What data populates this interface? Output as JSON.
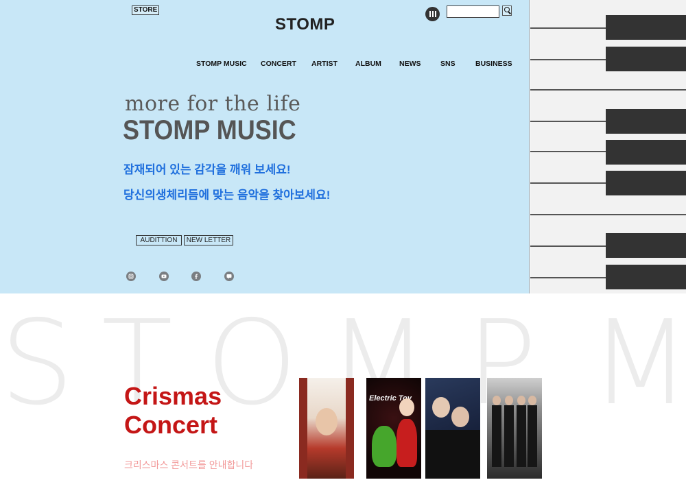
{
  "header": {
    "store_label": "STORE",
    "logo": "STOMP",
    "search_placeholder": ""
  },
  "nav": [
    "STOMP MUSIC",
    "CONCERT",
    "ARTIST",
    "ALBUM",
    "NEWS",
    "SNS",
    "BUSINESS"
  ],
  "hero": {
    "tagline": "more for the life",
    "title": "STOMP MUSIC",
    "line1": "잠재되어 있는 감각을 깨워 보세요!",
    "line2": "당신의생체리듬에 맞는 음악을 찾아보세요!",
    "audition_label": "AUDITTION",
    "newsletter_label": "NEW LETTER",
    "accent_color": "#1f6fdd",
    "bg_color": "#c8e7f7"
  },
  "social": {
    "icons": [
      "instagram-icon",
      "youtube-icon",
      "facebook-icon",
      "message-icon"
    ]
  },
  "watermark": [
    "S",
    "T",
    "O",
    "M",
    "P",
    "M"
  ],
  "concert": {
    "title_line1": "Crismas",
    "title_line2": "Concert",
    "subtitle": "크리스마스 콘서트를 안내합니다",
    "poster2_text": "Electric Toy",
    "title_color": "#c41616"
  }
}
